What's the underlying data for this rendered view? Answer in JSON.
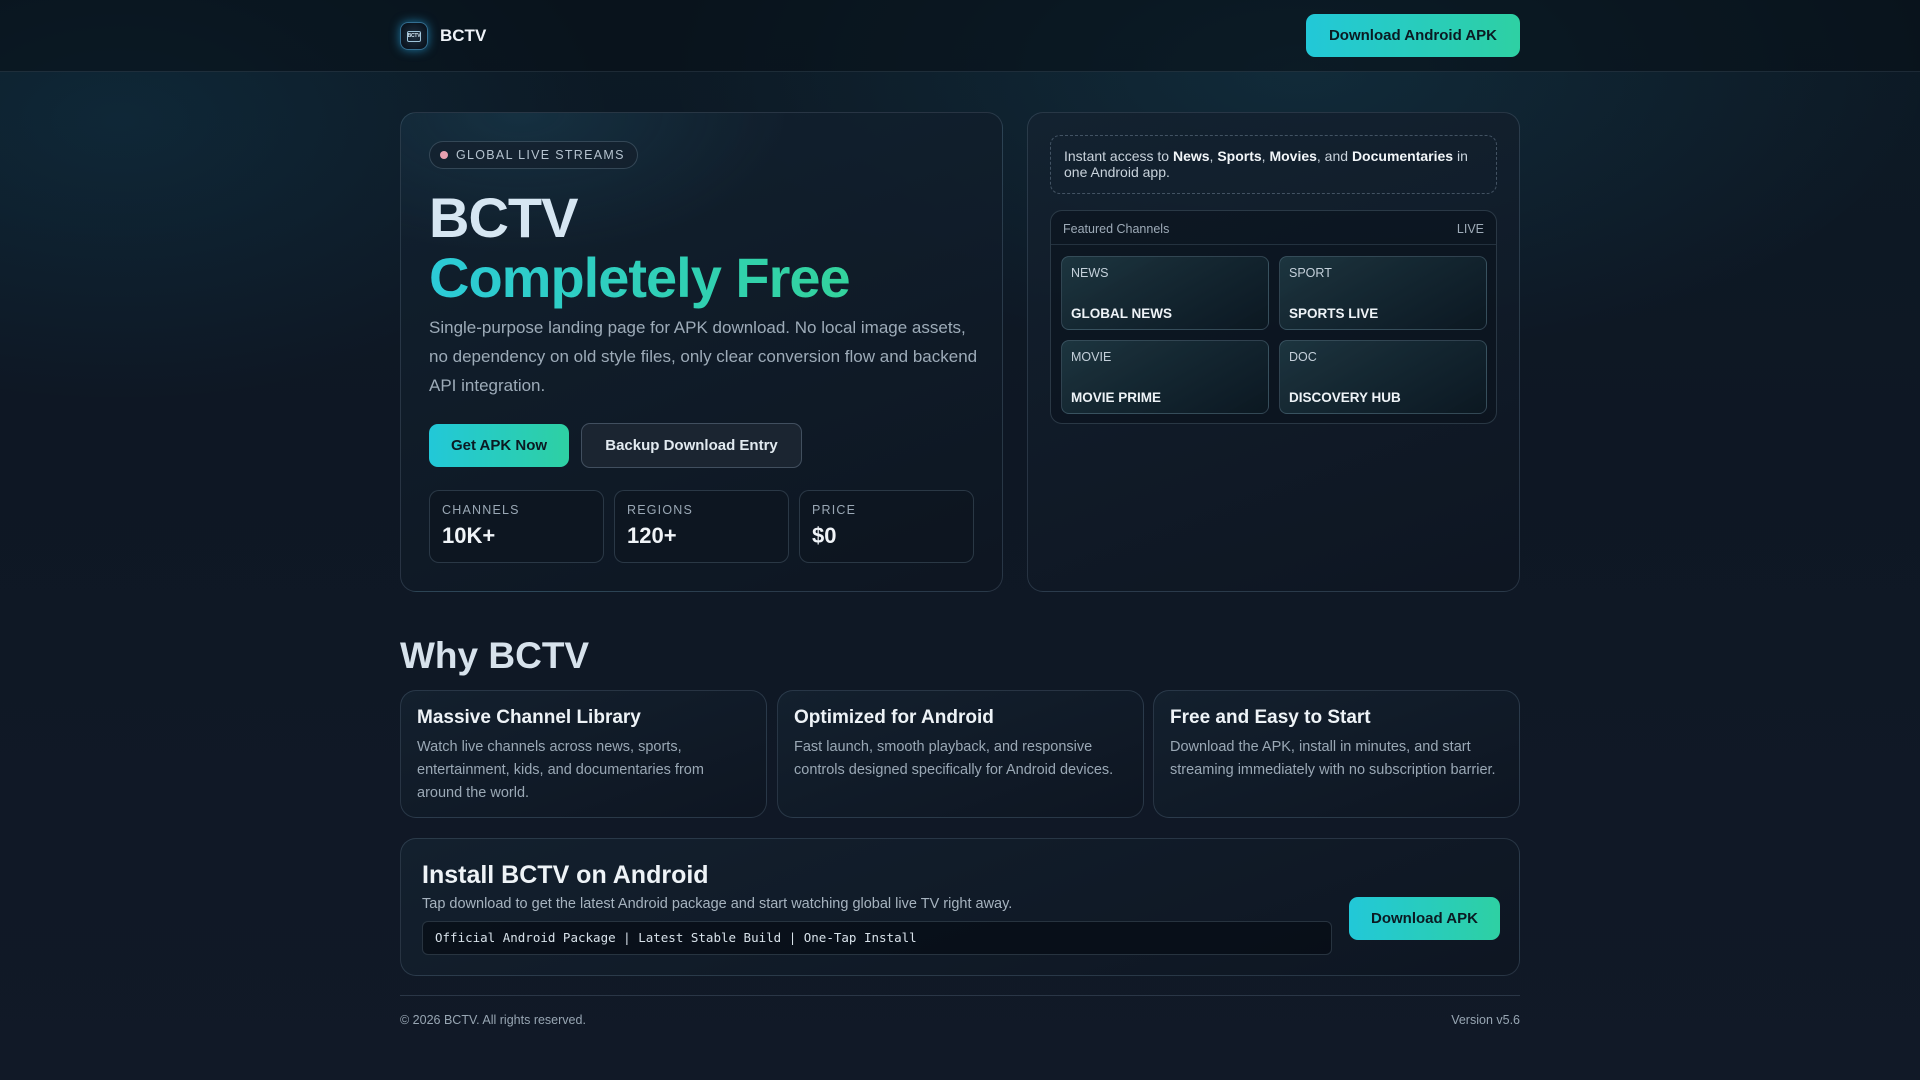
{
  "header": {
    "brand_name": "BCTV",
    "logo_text": "BCTV",
    "cta_label": "Download Android APK"
  },
  "hero": {
    "badge": "GLOBAL LIVE STREAMS",
    "title_line1": "BCTV",
    "title_line2": "Completely Free",
    "description": "Single-purpose landing page for APK download. No local image assets, no dependency on old style files, only clear conversion flow and backend API integration.",
    "primary_button": "Get APK Now",
    "secondary_button": "Backup Download Entry",
    "stats": [
      {
        "label": "CHANNELS",
        "value": "10K+"
      },
      {
        "label": "REGIONS",
        "value": "120+"
      },
      {
        "label": "PRICE",
        "value": "$0"
      }
    ]
  },
  "side_panel": {
    "notice_prefix": "Instant access to ",
    "notice_items": [
      "News",
      "Sports",
      "Movies",
      "Documentaries"
    ],
    "notice_sep1": ", ",
    "notice_sep2": ", ",
    "notice_sep3": ", and ",
    "notice_suffix": " in one Android app.",
    "featured_title": "Featured Channels",
    "featured_status": "LIVE",
    "channels": [
      {
        "category": "NEWS",
        "name": "GLOBAL NEWS"
      },
      {
        "category": "SPORT",
        "name": "SPORTS LIVE"
      },
      {
        "category": "MOVIE",
        "name": "MOVIE PRIME"
      },
      {
        "category": "DOC",
        "name": "DISCOVERY HUB"
      }
    ]
  },
  "why": {
    "title": "Why BCTV",
    "features": [
      {
        "title": "Massive Channel Library",
        "description": "Watch live channels across news, sports, entertainment, kids, and documentaries from around the world."
      },
      {
        "title": "Optimized for Android",
        "description": "Fast launch, smooth playback, and responsive controls designed specifically for Android devices."
      },
      {
        "title": "Free and Easy to Start",
        "description": "Download the APK, install in minutes, and start streaming immediately with no subscription barrier."
      }
    ]
  },
  "install": {
    "title": "Install BCTV on Android",
    "description": "Tap download to get the latest Android package and start watching global live TV right away.",
    "meta": "Official Android Package | Latest Stable Build | One-Tap Install",
    "button": "Download APK"
  },
  "footer": {
    "copyright": "© 2026 BCTV. All rights reserved.",
    "version": "Version v5.6"
  },
  "colors": {
    "accent_start": "#22c8d8",
    "accent_end": "#2ed0a3",
    "background": "#0e1724",
    "badge_dot": "#e7a0b0"
  },
  "icons": {
    "logo": "tv-logo-icon",
    "badge": "status-dot-icon"
  }
}
